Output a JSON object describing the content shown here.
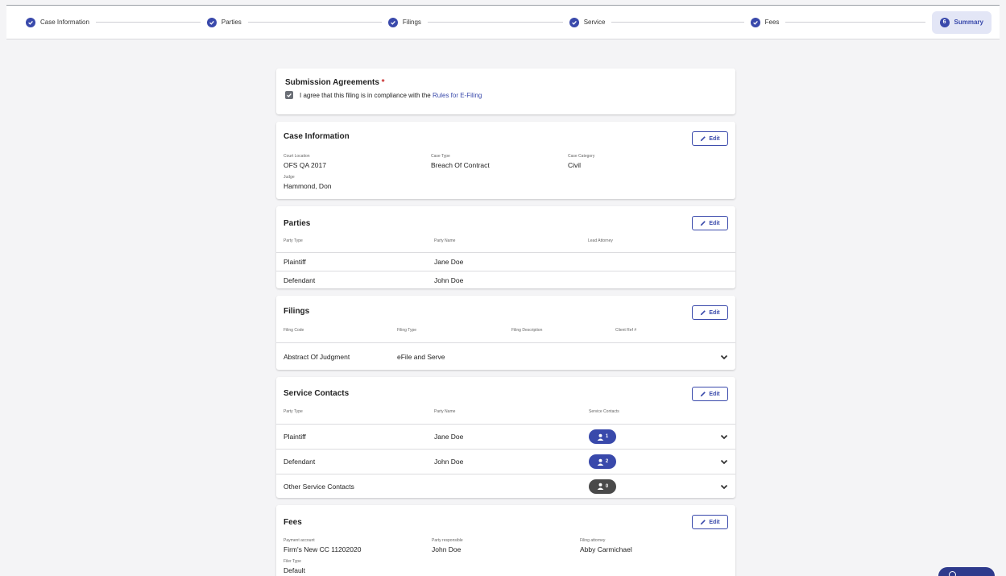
{
  "stepper": {
    "steps": [
      {
        "label": "Case Information"
      },
      {
        "label": "Parties"
      },
      {
        "label": "Filings"
      },
      {
        "label": "Service"
      },
      {
        "label": "Fees"
      }
    ],
    "active": {
      "number": "6",
      "label": "Summary"
    }
  },
  "agreements": {
    "title": "Submission Agreements",
    "required_mark": "*",
    "checkbox_checked": true,
    "text": "I agree that this filing is in compliance with the ",
    "link_text": "Rules for E-Filing"
  },
  "edit_label": "Edit",
  "case_info": {
    "title": "Case Information",
    "fields": [
      {
        "label": "Court Location",
        "value": "OFS QA 2017"
      },
      {
        "label": "Case Type",
        "value": "Breach Of Contract"
      },
      {
        "label": "Case Category",
        "value": "Civil"
      },
      {
        "label": "Judge",
        "value": "Hammond, Don"
      }
    ]
  },
  "parties": {
    "title": "Parties",
    "headers": [
      "Party Type",
      "Party Name",
      "Lead Attorney"
    ],
    "rows": [
      {
        "type": "Plaintiff",
        "name": "Jane Doe",
        "attorney": ""
      },
      {
        "type": "Defendant",
        "name": "John Doe",
        "attorney": ""
      }
    ]
  },
  "filings": {
    "title": "Filings",
    "headers": [
      "Filing Code",
      "Filing Type",
      "Filing Description",
      "Client Ref #"
    ],
    "rows": [
      {
        "code": "Abstract Of Judgment",
        "type": "eFile and Serve",
        "description": "",
        "client_ref": ""
      }
    ]
  },
  "service": {
    "title": "Service Contacts",
    "headers": [
      "Party Type",
      "Party Name",
      "Service Contacts"
    ],
    "rows": [
      {
        "type": "Plaintiff",
        "name": "Jane Doe",
        "count": "1",
        "badge_color": "#3949ab"
      },
      {
        "type": "Defendant",
        "name": "John Doe",
        "count": "2",
        "badge_color": "#3949ab"
      },
      {
        "type": "Other Service Contacts",
        "name": "",
        "count": "0",
        "badge_color": "#4a4a4a"
      }
    ]
  },
  "fees": {
    "title": "Fees",
    "fields": [
      {
        "label": "Payment account",
        "value": "Firm's New CC 11202020"
      },
      {
        "label": "Party responsible",
        "value": "John Doe"
      },
      {
        "label": "Filing attorney",
        "value": "Abby Carmichael"
      },
      {
        "label": "Filer Type",
        "value": "Default"
      }
    ]
  },
  "colors": {
    "accent": "#3949ab",
    "inactive_badge": "#4a4a4a",
    "background": "#f4f4f6"
  }
}
